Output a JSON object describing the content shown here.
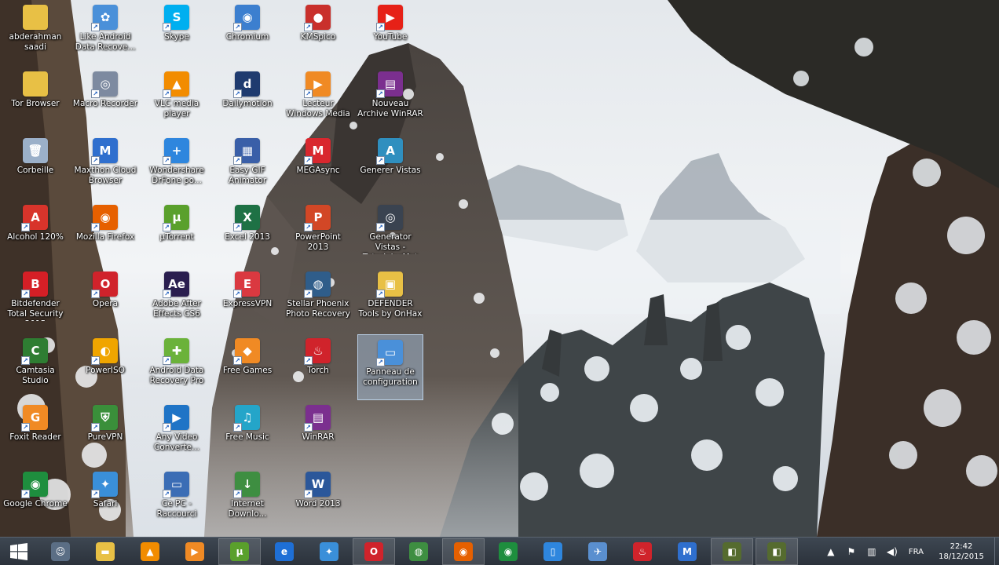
{
  "desktop_icons": [
    {
      "name": "abderahman-saadi-icon",
      "label": "abderahman saadi",
      "color": "#e8c045",
      "glyph": ""
    },
    {
      "name": "tor-browser-icon",
      "label": "Tor Browser",
      "color": "#e8c045",
      "glyph": ""
    },
    {
      "name": "recycle-bin-icon",
      "label": "Corbeille",
      "color": "#9bb0c9",
      "glyph": "🗑"
    },
    {
      "name": "alcohol-icon",
      "label": "Alcohol 120%",
      "color": "#d8342b",
      "glyph": "A"
    },
    {
      "name": "bitdefender-icon",
      "label": "Bitdefender Total Security 2015",
      "color": "#d51f26",
      "glyph": "B"
    },
    {
      "name": "camtasia-icon",
      "label": "Camtasia Studio",
      "color": "#2e7d32",
      "glyph": "C"
    },
    {
      "name": "foxit-reader-icon",
      "label": "Foxit Reader",
      "color": "#f08a24",
      "glyph": "G"
    },
    {
      "name": "google-chrome-icon",
      "label": "Google Chrome",
      "color": "#1e8e3e",
      "glyph": "◉"
    },
    {
      "name": "like-android-icon",
      "label": "Like Android Data Recove...",
      "color": "#4a90d9",
      "glyph": "✿"
    },
    {
      "name": "macro-recorder-icon",
      "label": "Macro Recorder",
      "color": "#7d8aa0",
      "glyph": "◎"
    },
    {
      "name": "manticore-cloud-icon",
      "label": "Maxthon Cloud Browser",
      "color": "#2f6fce",
      "glyph": "M"
    },
    {
      "name": "mozilla-firefox-icon",
      "label": "Mozilla Firefox",
      "color": "#e66000",
      "glyph": "◉"
    },
    {
      "name": "opera-icon",
      "label": "Opera",
      "color": "#d0232b",
      "glyph": "O"
    },
    {
      "name": "poweriso-icon",
      "label": "PowerISO",
      "color": "#f0a500",
      "glyph": "◐"
    },
    {
      "name": "purevpn-icon",
      "label": "PureVPN",
      "color": "#3a8f3a",
      "glyph": "⛨"
    },
    {
      "name": "safari-icon",
      "label": "Safari",
      "color": "#3a8fd9",
      "glyph": "✦"
    },
    {
      "name": "skype-icon",
      "label": "Skype",
      "color": "#00aff0",
      "glyph": "S"
    },
    {
      "name": "vlc-icon",
      "label": "VLC media player",
      "color": "#f28c00",
      "glyph": "▲"
    },
    {
      "name": "wondershare-icon",
      "label": "Wondershare DrFone po...",
      "color": "#2e86de",
      "glyph": "+"
    },
    {
      "name": "utorrent-icon",
      "label": "µTorrent",
      "color": "#5aa02c",
      "glyph": "µ"
    },
    {
      "name": "after-effects-icon",
      "label": "Adobe After Effects CS6",
      "color": "#2a1e4f",
      "glyph": "Ae"
    },
    {
      "name": "android-data-icon",
      "label": "Android Data Recovery Pro",
      "color": "#6bb23a",
      "glyph": "✚"
    },
    {
      "name": "any-video-icon",
      "label": "Any Video Converte...",
      "color": "#1f74c6",
      "glyph": "▶"
    },
    {
      "name": "ce-pc-icon",
      "label": "Ce PC - Raccourci",
      "color": "#3b6db5",
      "glyph": "▭"
    },
    {
      "name": "chromium-icon",
      "label": "Chromium",
      "color": "#3c7fcf",
      "glyph": "◉"
    },
    {
      "name": "dailymotion-icon",
      "label": "Dailymotion",
      "color": "#1f3b6f",
      "glyph": "d"
    },
    {
      "name": "easy-gif-icon",
      "label": "Easy GIF Animator",
      "color": "#3a5fa8",
      "glyph": "▦"
    },
    {
      "name": "excel-icon",
      "label": "Excel 2013",
      "color": "#1e7145",
      "glyph": "X"
    },
    {
      "name": "expressvpn-icon",
      "label": "ExpressVPN",
      "color": "#da3940",
      "glyph": "E"
    },
    {
      "name": "free-games-icon",
      "label": "Free Games",
      "color": "#f08a24",
      "glyph": "◆"
    },
    {
      "name": "free-music-icon",
      "label": "Free Music",
      "color": "#24a5c9",
      "glyph": "♫"
    },
    {
      "name": "internet-download-icon",
      "label": "Internet Downlo...",
      "color": "#3e8e41",
      "glyph": "↓"
    },
    {
      "name": "kmspico-icon",
      "label": "KMSpico",
      "color": "#c9302c",
      "glyph": "●"
    },
    {
      "name": "lecteur-windows-media-icon",
      "label": "Lecteur Windows Media",
      "color": "#f08a24",
      "glyph": "▶"
    },
    {
      "name": "megasync-icon",
      "label": "MEGAsync",
      "color": "#d9272e",
      "glyph": "M"
    },
    {
      "name": "powerpoint-icon",
      "label": "PowerPoint 2013",
      "color": "#d24726",
      "glyph": "P"
    },
    {
      "name": "stellar-phoenix-icon",
      "label": "Stellar Phoenix Photo Recovery",
      "color": "#2f5d8a",
      "glyph": "◍"
    },
    {
      "name": "torch-icon",
      "label": "Torch",
      "color": "#d0232b",
      "glyph": "♨"
    },
    {
      "name": "winrar-icon",
      "label": "WinRAR",
      "color": "#7b2f8f",
      "glyph": "▤"
    },
    {
      "name": "word-icon",
      "label": "Word 2013",
      "color": "#2b579a",
      "glyph": "W"
    },
    {
      "name": "youtube-icon",
      "label": "YouTube",
      "color": "#e62117",
      "glyph": "▶"
    },
    {
      "name": "nouveau-archive-icon",
      "label": "Nouveau Archive WinRAR",
      "color": "#7b2f8f",
      "glyph": "▤"
    },
    {
      "name": "generer-vistas-icon",
      "label": "Generer Vistas",
      "color": "#2f8fbf",
      "glyph": "A"
    },
    {
      "name": "generator-vistas-icon",
      "label": "Generator Vistas - TutorialesMat",
      "color": "#3a4350",
      "glyph": "◎"
    },
    {
      "name": "defender-tools-icon",
      "label": "DEFENDER Tools by OnHax",
      "color": "#e8c045",
      "glyph": "▣"
    },
    {
      "name": "panneau-config-icon",
      "label": "Panneau de configuration",
      "color": "#4a90d9",
      "glyph": "▭"
    }
  ],
  "taskbar": {
    "items": [
      {
        "name": "taskbar-cortana-icon",
        "color": "#5b6e85",
        "glyph": "☺"
      },
      {
        "name": "taskbar-explorer-icon",
        "color": "#e8c045",
        "glyph": "▬"
      },
      {
        "name": "taskbar-vlc-icon",
        "color": "#f28c00",
        "glyph": "▲"
      },
      {
        "name": "taskbar-media-player-icon",
        "color": "#f08a24",
        "glyph": "▶"
      },
      {
        "name": "taskbar-utorrent-icon",
        "color": "#5aa02c",
        "glyph": "µ"
      },
      {
        "name": "taskbar-ie-icon",
        "color": "#1e6fd6",
        "glyph": "e"
      },
      {
        "name": "taskbar-safari-icon",
        "color": "#3a8fd9",
        "glyph": "✦"
      },
      {
        "name": "taskbar-opera-icon",
        "color": "#d0232b",
        "glyph": "O"
      },
      {
        "name": "taskbar-globe-icon",
        "color": "#3e8e41",
        "glyph": "◍"
      },
      {
        "name": "taskbar-firefox-icon",
        "color": "#e66000",
        "glyph": "◉"
      },
      {
        "name": "taskbar-chrome-icon",
        "color": "#1e8e3e",
        "glyph": "◉"
      },
      {
        "name": "taskbar-phone-icon",
        "color": "#2e86de",
        "glyph": "▯"
      },
      {
        "name": "taskbar-bird-icon",
        "color": "#5a8fcf",
        "glyph": "✈"
      },
      {
        "name": "taskbar-torch-icon",
        "color": "#d0232b",
        "glyph": "♨"
      },
      {
        "name": "taskbar-maxthon-icon",
        "color": "#2f6fce",
        "glyph": "M"
      },
      {
        "name": "taskbar-app1-icon",
        "color": "#556b2f",
        "glyph": "◧"
      },
      {
        "name": "taskbar-app2-icon",
        "color": "#556b2f",
        "glyph": "◧"
      }
    ],
    "language": "FRA",
    "time": "22:42",
    "date": "18/12/2015"
  }
}
